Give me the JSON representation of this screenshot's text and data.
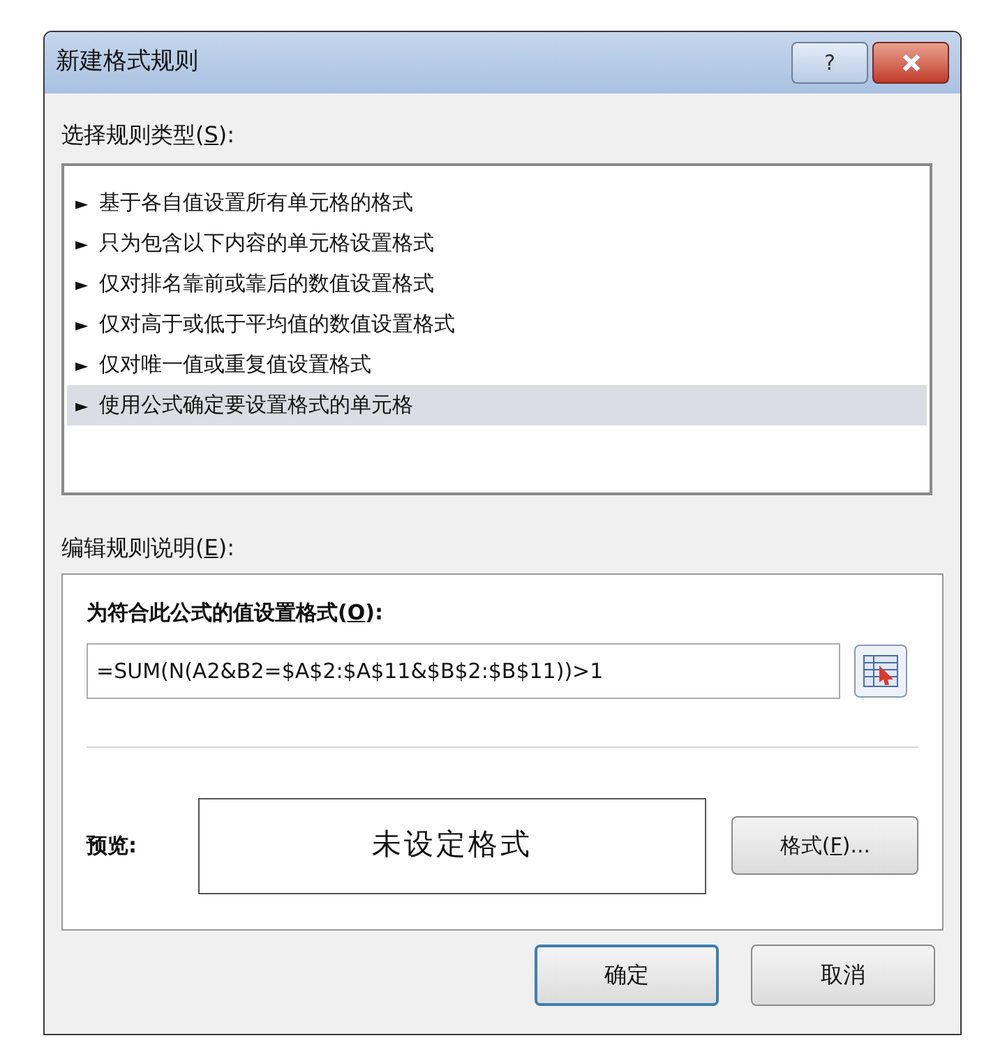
{
  "window": {
    "title": "新建格式规则",
    "help_button": "?"
  },
  "rule_type": {
    "label": {
      "before": "选择规则类型(",
      "key": "S",
      "after": "):"
    },
    "items": [
      {
        "arrow": "►",
        "text": "基于各自值设置所有单元格的格式",
        "selected": false
      },
      {
        "arrow": "►",
        "text": "只为包含以下内容的单元格设置格式",
        "selected": false
      },
      {
        "arrow": "►",
        "text": "仅对排名靠前或靠后的数值设置格式",
        "selected": false
      },
      {
        "arrow": "►",
        "text": "仅对高于或低于平均值的数值设置格式",
        "selected": false
      },
      {
        "arrow": "►",
        "text": "仅对唯一值或重复值设置格式",
        "selected": false
      },
      {
        "arrow": "►",
        "text": "使用公式确定要设置格式的单元格",
        "selected": true
      }
    ]
  },
  "description": {
    "label": {
      "before": "编辑规则说明(",
      "key": "E",
      "after": "):"
    },
    "formula_label": {
      "before": "为符合此公式的值设置格式(",
      "key": "O",
      "after": "):"
    },
    "formula": "=SUM(N(A2&B2=$A$2:$A$11&$B$2:$B$11))>1",
    "preview_label": "预览:",
    "preview_text": "未设定格式",
    "format_button": {
      "before": "格式(",
      "key": "F",
      "after": ")..."
    }
  },
  "buttons": [
    {
      "text": "确定",
      "default": true
    },
    {
      "text": "取消",
      "default": false
    }
  ]
}
